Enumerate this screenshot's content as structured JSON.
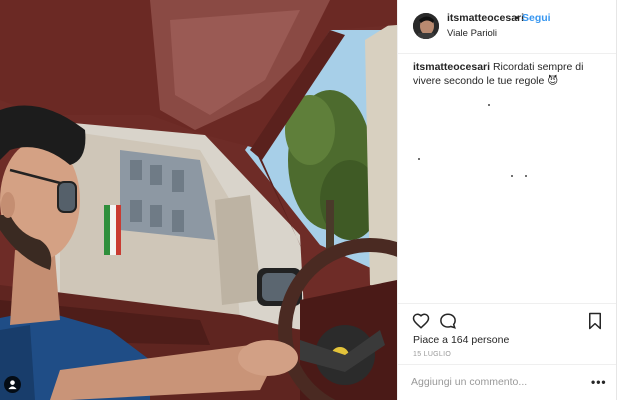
{
  "post": {
    "username": "itsmatteocesari",
    "separator": "•",
    "follow_label": "Segui",
    "location": "Viale Parioli",
    "caption_user": "itsmatteocesari",
    "caption_text": "Ricordati sempre di vivere secondo le tue regole",
    "caption_emoji": "😈",
    "likes_text": "Piace a 164 persone",
    "date": "15 LUGLIO",
    "comment_placeholder": "Aggiungi un commento...",
    "more_label": "•••"
  },
  "icons": {
    "like": "heart-icon",
    "comment": "comment-icon",
    "save": "bookmark-icon",
    "tag": "user-tag-icon"
  }
}
